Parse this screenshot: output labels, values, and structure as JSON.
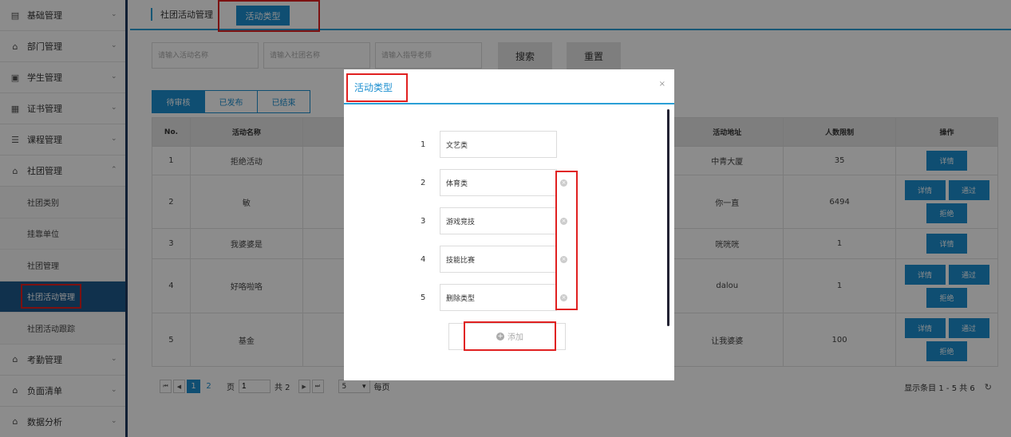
{
  "sidebar": {
    "items": [
      {
        "label": "基础管理",
        "icon": "list-icon"
      },
      {
        "label": "部门管理",
        "icon": "building-icon"
      },
      {
        "label": "学生管理",
        "icon": "student-icon"
      },
      {
        "label": "证书管理",
        "icon": "certificate-icon"
      },
      {
        "label": "课程管理",
        "icon": "course-icon"
      },
      {
        "label": "社团管理",
        "icon": "building-icon"
      }
    ],
    "sub_items": [
      {
        "label": "社团类别"
      },
      {
        "label": "挂靠单位"
      },
      {
        "label": "社团管理"
      },
      {
        "label": "社团活动管理"
      },
      {
        "label": "社团活动跟踪"
      }
    ],
    "bottom_items": [
      {
        "label": "考勤管理",
        "icon": "building-icon"
      },
      {
        "label": "负面清单",
        "icon": "building-icon"
      },
      {
        "label": "数据分析",
        "icon": "building-icon"
      }
    ]
  },
  "topbar": {
    "breadcrumb": "社团活动管理",
    "active_tab": "活动类型"
  },
  "search": {
    "activity_name_placeholder": "请输入活动名称",
    "club_name_placeholder": "请输入社团名称",
    "teacher_placeholder": "请输入指导老师",
    "search_label": "搜索",
    "reset_label": "重置"
  },
  "status_tabs": [
    "待审核",
    "已发布",
    "已结束"
  ],
  "table": {
    "headers": {
      "no": "No.",
      "name": "活动名称",
      "address": "活动地址",
      "limit": "人数限制",
      "actions": "操作"
    },
    "rows": [
      {
        "no": "1",
        "name": "拒绝活动",
        "address": "中青大厦",
        "limit": "35"
      },
      {
        "no": "2",
        "name": "敏",
        "address": "你一直",
        "limit": "6494"
      },
      {
        "no": "3",
        "name": "我婆婆是",
        "address": "咣咣咣",
        "limit": "1"
      },
      {
        "no": "4",
        "name": "好咯啦咯",
        "address": "dalou",
        "limit": "1"
      },
      {
        "no": "5",
        "name": "基金",
        "address": "让我婆婆",
        "limit": "100"
      }
    ],
    "detail_label": "详情",
    "approve_label": "通过",
    "reject_label": "拒绝"
  },
  "pager": {
    "page1": "1",
    "page2": "2",
    "page_label": "页",
    "current_page": "1",
    "total_label": "共 2",
    "page_size": "5",
    "per_page_label": "每页",
    "summary": "显示条目 1 - 5 共 6"
  },
  "modal": {
    "title": "活动类型",
    "close": "×",
    "types": [
      {
        "num": "1",
        "value": "文艺类"
      },
      {
        "num": "2",
        "value": "体育类"
      },
      {
        "num": "3",
        "value": "游戏竞技"
      },
      {
        "num": "4",
        "value": "技能比赛"
      },
      {
        "num": "5",
        "value": "删除类型"
      }
    ],
    "add_label": "添加"
  }
}
